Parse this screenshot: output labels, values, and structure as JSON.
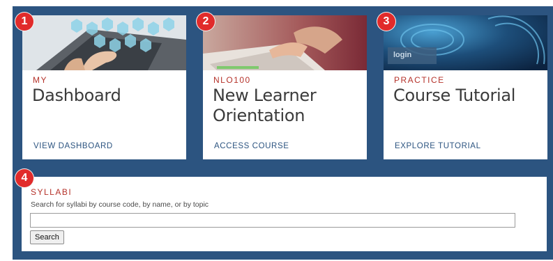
{
  "cards": [
    {
      "badge": "1",
      "eyebrow": "MY",
      "title": "Dashboard",
      "link": "VIEW DASHBOARD"
    },
    {
      "badge": "2",
      "eyebrow": "NLO100",
      "title": "New Learner Orientation",
      "link": "ACCESS COURSE"
    },
    {
      "badge": "3",
      "eyebrow": "PRACTICE",
      "title": "Course Tutorial",
      "link": "EXPLORE TUTORIAL",
      "image_text": "login"
    }
  ],
  "syllabi": {
    "badge": "4",
    "eyebrow": "SYLLABI",
    "description": "Search for syllabi by course code, by name, or by topic",
    "input_value": "",
    "button_label": "Search"
  },
  "colors": {
    "panel_background": "#2c5480",
    "eyebrow_red": "#b5322a",
    "badge_red": "#e12b2b",
    "link_blue": "#2c5480"
  }
}
